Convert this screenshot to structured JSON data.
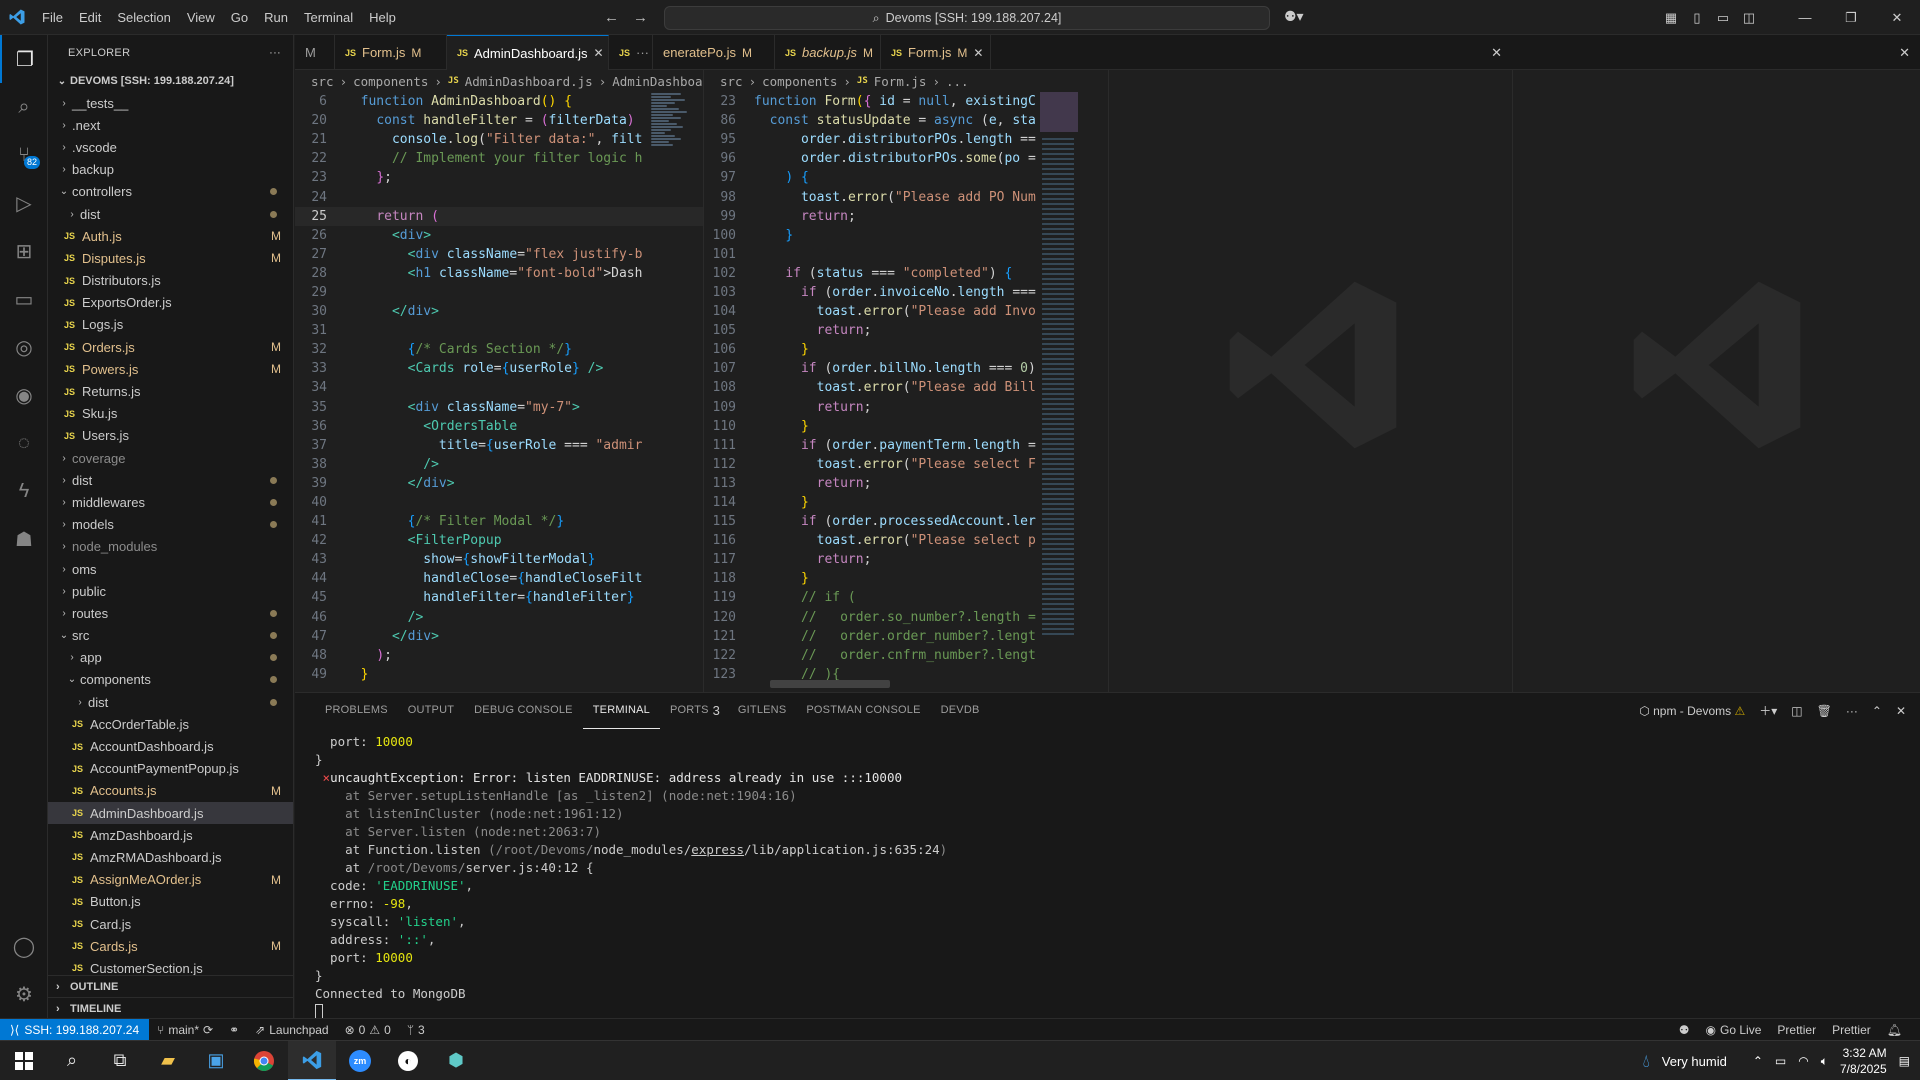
{
  "menu": [
    "File",
    "Edit",
    "Selection",
    "View",
    "Go",
    "Run",
    "Terminal",
    "Help"
  ],
  "command_center": "Devoms [SSH: 199.188.207.24]",
  "explorer": {
    "title": "EXPLORER",
    "root": "DEVOMS [SSH: 199.188.207.24]",
    "items": [
      {
        "label": "__tests__",
        "indent": 1,
        "type": "folder",
        "open": false
      },
      {
        "label": ".next",
        "indent": 1,
        "type": "folder",
        "open": false
      },
      {
        "label": ".vscode",
        "indent": 1,
        "type": "folder",
        "open": false
      },
      {
        "label": "backup",
        "indent": 1,
        "type": "folder",
        "open": false
      },
      {
        "label": "controllers",
        "indent": 1,
        "type": "folder",
        "open": true,
        "dot": true
      },
      {
        "label": "dist",
        "indent": 2,
        "type": "folder",
        "open": false,
        "dot": true
      },
      {
        "label": "Auth.js",
        "indent": 2,
        "type": "js",
        "status": "M"
      },
      {
        "label": "Disputes.js",
        "indent": 2,
        "type": "js",
        "status": "M"
      },
      {
        "label": "Distributors.js",
        "indent": 2,
        "type": "js"
      },
      {
        "label": "ExportsOrder.js",
        "indent": 2,
        "type": "js"
      },
      {
        "label": "Logs.js",
        "indent": 2,
        "type": "js"
      },
      {
        "label": "Orders.js",
        "indent": 2,
        "type": "js",
        "status": "M"
      },
      {
        "label": "Powers.js",
        "indent": 2,
        "type": "js",
        "status": "M"
      },
      {
        "label": "Returns.js",
        "indent": 2,
        "type": "js"
      },
      {
        "label": "Sku.js",
        "indent": 2,
        "type": "js"
      },
      {
        "label": "Users.js",
        "indent": 2,
        "type": "js"
      },
      {
        "label": "coverage",
        "indent": 1,
        "type": "folder",
        "open": false,
        "dim": true
      },
      {
        "label": "dist",
        "indent": 1,
        "type": "folder",
        "open": false,
        "dot": true
      },
      {
        "label": "middlewares",
        "indent": 1,
        "type": "folder",
        "open": false,
        "dot": true
      },
      {
        "label": "models",
        "indent": 1,
        "type": "folder",
        "open": false,
        "dot": true
      },
      {
        "label": "node_modules",
        "indent": 1,
        "type": "folder",
        "open": false,
        "dim": true
      },
      {
        "label": "oms",
        "indent": 1,
        "type": "folder",
        "open": false
      },
      {
        "label": "public",
        "indent": 1,
        "type": "folder",
        "open": false
      },
      {
        "label": "routes",
        "indent": 1,
        "type": "folder",
        "open": false,
        "dot": true
      },
      {
        "label": "src",
        "indent": 1,
        "type": "folder",
        "open": true,
        "dot": true
      },
      {
        "label": "app",
        "indent": 2,
        "type": "folder",
        "open": false,
        "dot": true
      },
      {
        "label": "components",
        "indent": 2,
        "type": "folder",
        "open": true,
        "dot": true
      },
      {
        "label": "dist",
        "indent": 3,
        "type": "folder",
        "open": false,
        "dot": true
      },
      {
        "label": "AccOrderTable.js",
        "indent": 3,
        "type": "js"
      },
      {
        "label": "AccountDashboard.js",
        "indent": 3,
        "type": "js"
      },
      {
        "label": "AccountPaymentPopup.js",
        "indent": 3,
        "type": "js"
      },
      {
        "label": "Accounts.js",
        "indent": 3,
        "type": "js",
        "status": "M"
      },
      {
        "label": "AdminDashboard.js",
        "indent": 3,
        "type": "js",
        "selected": true
      },
      {
        "label": "AmzDashboard.js",
        "indent": 3,
        "type": "js"
      },
      {
        "label": "AmzRMADashboard.js",
        "indent": 3,
        "type": "js"
      },
      {
        "label": "AssignMeAOrder.js",
        "indent": 3,
        "type": "js",
        "status": "M"
      },
      {
        "label": "Button.js",
        "indent": 3,
        "type": "js"
      },
      {
        "label": "Card.js",
        "indent": 3,
        "type": "js"
      },
      {
        "label": "Cards.js",
        "indent": 3,
        "type": "js",
        "status": "M"
      },
      {
        "label": "CustomerSection.js",
        "indent": 3,
        "type": "js"
      }
    ],
    "outline": "OUTLINE",
    "timeline": "TIMELINE"
  },
  "tabs": [
    {
      "label": "M",
      "js": false,
      "modified": false
    },
    {
      "label": "Form.js",
      "js": true,
      "modified": "M"
    },
    {
      "label": "AdminDashboard.js",
      "js": true,
      "active": true,
      "close": true
    },
    {
      "label": "",
      "js": true,
      "more": true
    },
    {
      "label": "eneratePo.js",
      "js": false,
      "modified": "M"
    },
    {
      "label": "backup.js",
      "js": true,
      "modified": "M",
      "italic": true
    },
    {
      "label": "Form.js",
      "js": true,
      "modified": "M",
      "close": true,
      "active": true
    }
  ],
  "left_editor": {
    "breadcrumb": [
      "src",
      "components",
      "AdminDashboard.js",
      "AdminDashboarc"
    ],
    "lines": [
      {
        "n": "6",
        "html": "  <span class='kw'>function</span> <span class='fn'>AdminDashboard</span><span class='br1'>()</span> <span class='br1'>{</span>"
      },
      {
        "n": "20",
        "html": "    <span class='kw'>const</span> <span class='fn'>handleFilter</span> = <span class='br2'>(</span><span class='var'>filterData</span><span class='br2'>)</span>"
      },
      {
        "n": "21",
        "html": "      <span class='var'>console</span>.<span class='fn'>log</span>(<span class='str'>\"Filter data:\"</span>, <span class='var'>filt</span>"
      },
      {
        "n": "22",
        "html": "      <span class='cm'>// Implement your filter logic h</span>"
      },
      {
        "n": "23",
        "html": "    <span class='br2'>}</span>;"
      },
      {
        "n": "24",
        "html": ""
      },
      {
        "n": "25",
        "html": "    <span class='ctl'>return</span> <span class='br2'>(</span>",
        "cur": true
      },
      {
        "n": "26",
        "html": "      <span class='tag'>&lt;</span><span class='kw'>div</span><span class='tag'>&gt;</span>"
      },
      {
        "n": "27",
        "html": "        <span class='tag'>&lt;</span><span class='kw'>div</span> <span class='var'>className</span>=<span class='str'>\"flex justify-b</span>"
      },
      {
        "n": "28",
        "html": "        <span class='tag'>&lt;</span><span class='kw'>h1</span> <span class='var'>className</span>=<span class='str'>\"font-bold\"</span>&gt;Dash"
      },
      {
        "n": "29",
        "html": ""
      },
      {
        "n": "30",
        "html": "      <span class='tag'>&lt;/</span><span class='kw'>div</span><span class='tag'>&gt;</span>"
      },
      {
        "n": "31",
        "html": ""
      },
      {
        "n": "32",
        "html": "        <span class='br3'>{</span><span class='cm'>/* Cards Section */</span><span class='br3'>}</span>"
      },
      {
        "n": "33",
        "html": "        <span class='tag'>&lt;Cards</span> <span class='var'>role</span>=<span class='br3'>{</span><span class='var'>userRole</span><span class='br3'>}</span> <span class='tag'>/&gt;</span>"
      },
      {
        "n": "34",
        "html": ""
      },
      {
        "n": "35",
        "html": "        <span class='tag'>&lt;</span><span class='kw'>div</span> <span class='var'>className</span>=<span class='str'>\"my-7\"</span><span class='tag'>&gt;</span>"
      },
      {
        "n": "36",
        "html": "          <span class='tag'>&lt;OrdersTable</span>"
      },
      {
        "n": "37",
        "html": "            <span class='var'>title</span>=<span class='br3'>{</span><span class='var'>userRole</span> === <span class='str'>\"admir</span>"
      },
      {
        "n": "38",
        "html": "          <span class='tag'>/&gt;</span>"
      },
      {
        "n": "39",
        "html": "        <span class='tag'>&lt;/</span><span class='kw'>div</span><span class='tag'>&gt;</span>"
      },
      {
        "n": "40",
        "html": ""
      },
      {
        "n": "41",
        "html": "        <span class='br3'>{</span><span class='cm'>/* Filter Modal */</span><span class='br3'>}</span>"
      },
      {
        "n": "42",
        "html": "        <span class='tag'>&lt;FilterPopup</span>"
      },
      {
        "n": "43",
        "html": "          <span class='var'>show</span>=<span class='br3'>{</span><span class='var'>showFilterModal</span><span class='br3'>}</span>"
      },
      {
        "n": "44",
        "html": "          <span class='var'>handleClose</span>=<span class='br3'>{</span><span class='var'>handleCloseFilt</span>"
      },
      {
        "n": "45",
        "html": "          <span class='var'>handleFilter</span>=<span class='br3'>{</span><span class='var'>handleFilter</span><span class='br3'>}</span>"
      },
      {
        "n": "46",
        "html": "        <span class='tag'>/&gt;</span>"
      },
      {
        "n": "47",
        "html": "      <span class='tag'>&lt;/</span><span class='kw'>div</span><span class='tag'>&gt;</span>"
      },
      {
        "n": "48",
        "html": "    <span class='br2'>)</span>;"
      },
      {
        "n": "49",
        "html": "  <span class='br1'>}</span>"
      }
    ]
  },
  "right_editor": {
    "breadcrumb": [
      "src",
      "components",
      "Form.js",
      "..."
    ],
    "lines": [
      {
        "n": "23",
        "html": "<span class='kw'>function</span> <span class='fn'>Form</span><span class='br1'>(</span><span class='br2'>{</span> <span class='var'>id</span> = <span class='kw'>null</span>, <span class='var'>existingC</span>"
      },
      {
        "n": "86",
        "html": "  <span class='kw'>const</span> <span class='fn'>statusUpdate</span> = <span class='kw'>async</span> (<span class='var'>e</span>, <span class='var'>sta</span>"
      },
      {
        "n": "95",
        "html": "      <span class='var'>order</span>.<span class='var'>distributorPOs</span>.<span class='var'>length</span> =="
      },
      {
        "n": "96",
        "html": "      <span class='var'>order</span>.<span class='var'>distributorPOs</span>.<span class='fn'>some</span>(<span class='var'>po</span> ="
      },
      {
        "n": "97",
        "html": "    <span class='br3'>)</span> <span class='br3'>{</span>"
      },
      {
        "n": "98",
        "html": "      <span class='var'>toast</span>.<span class='fn'>error</span>(<span class='str'>\"Please add PO Num</span>"
      },
      {
        "n": "99",
        "html": "      <span class='ctl'>return</span>;"
      },
      {
        "n": "100",
        "html": "    <span class='br3'>}</span>"
      },
      {
        "n": "101",
        "html": ""
      },
      {
        "n": "102",
        "html": "    <span class='ctl'>if</span> (<span class='var'>status</span> === <span class='str'>\"completed\"</span>) <span class='br3'>{</span>"
      },
      {
        "n": "103",
        "html": "      <span class='ctl'>if</span> (<span class='var'>order</span>.<span class='var'>invoiceNo</span>.<span class='var'>length</span> ==="
      },
      {
        "n": "104",
        "html": "        <span class='var'>toast</span>.<span class='fn'>error</span>(<span class='str'>\"Please add Invo</span>"
      },
      {
        "n": "105",
        "html": "        <span class='ctl'>return</span>;"
      },
      {
        "n": "106",
        "html": "      <span class='br1'>}</span>"
      },
      {
        "n": "107",
        "html": "      <span class='ctl'>if</span> (<span class='var'>order</span>.<span class='var'>billNo</span>.<span class='var'>length</span> === <span class='num'>0</span>)"
      },
      {
        "n": "108",
        "html": "        <span class='var'>toast</span>.<span class='fn'>error</span>(<span class='str'>\"Please add Bill</span>"
      },
      {
        "n": "109",
        "html": "        <span class='ctl'>return</span>;"
      },
      {
        "n": "110",
        "html": "      <span class='br1'>}</span>"
      },
      {
        "n": "111",
        "html": "      <span class='ctl'>if</span> (<span class='var'>order</span>.<span class='var'>paymentTerm</span>.<span class='var'>length</span> ="
      },
      {
        "n": "112",
        "html": "        <span class='var'>toast</span>.<span class='fn'>error</span>(<span class='str'>\"Please select F</span>"
      },
      {
        "n": "113",
        "html": "        <span class='ctl'>return</span>;"
      },
      {
        "n": "114",
        "html": "      <span class='br1'>}</span>"
      },
      {
        "n": "115",
        "html": "      <span class='ctl'>if</span> (<span class='var'>order</span>.<span class='var'>processedAccount</span>.<span class='var'>ler</span>"
      },
      {
        "n": "116",
        "html": "        <span class='var'>toast</span>.<span class='fn'>error</span>(<span class='str'>\"Please select p</span>"
      },
      {
        "n": "117",
        "html": "        <span class='ctl'>return</span>;"
      },
      {
        "n": "118",
        "html": "      <span class='br1'>}</span>"
      },
      {
        "n": "119",
        "html": "      <span class='cm'>// if (</span>"
      },
      {
        "n": "120",
        "html": "      <span class='cm'>//   order.so_number?.length =</span>"
      },
      {
        "n": "121",
        "html": "      <span class='cm'>//   order.order_number?.lengt</span>"
      },
      {
        "n": "122",
        "html": "      <span class='cm'>//   order.cnfrm_number?.lengt</span>"
      },
      {
        "n": "123",
        "html": "      <span class='cm'>// ){</span>"
      }
    ]
  },
  "panel": {
    "tabs": [
      "PROBLEMS",
      "OUTPUT",
      "DEBUG CONSOLE",
      "TERMINAL",
      "PORTS",
      "GITLENS",
      "POSTMAN CONSOLE",
      "DEVDB"
    ],
    "active_tab": "TERMINAL",
    "ports_count": "3",
    "terminal_name": "npm - Devoms",
    "terminal_lines": [
      {
        "html": "  port: <span class='t-yel'>10000</span>"
      },
      {
        "html": "}"
      },
      {
        "html": "<span class='t-red'> ×</span> <span class='t-wht'>uncaughtException: Error: listen EADDRINUSE: address already in use :::10000</span>"
      },
      {
        "html": "<span class='t-dim'>    at Server.setupListenHandle [as _listen2] (node:net:1904:16)</span>"
      },
      {
        "html": "<span class='t-dim'>    at listenInCluster (node:net:1961:12)</span>"
      },
      {
        "html": "<span class='t-dim'>    at Server.listen (node:net:2063:7)</span>"
      },
      {
        "html": "    at Function.listen <span class='t-dim'>(/root/Devoms/</span>node_modules/<u>express</u>/lib/application.js:635:24<span class='t-dim'>)</span>"
      },
      {
        "html": "    at <span class='t-dim'>/root/Devoms/</span>server.js:40:12 {"
      },
      {
        "html": "  code: <span class='t-grn'>'EADDRINUSE'</span>,"
      },
      {
        "html": "  errno: <span class='t-yel'>-98</span>,"
      },
      {
        "html": "  syscall: <span class='t-grn'>'listen'</span>,"
      },
      {
        "html": "  address: <span class='t-grn'>'::'</span>,"
      },
      {
        "html": "  port: <span class='t-yel'>10000</span>"
      },
      {
        "html": "}"
      },
      {
        "html": "Connected to MongoDB"
      },
      {
        "html": "<span style='display:inline-block;width:8px;height:15px;border:1px solid #ccc;'></span>"
      }
    ]
  },
  "statusbar": {
    "remote": "SSH: 199.188.207.24",
    "branch": "main*",
    "launchpad": "Launchpad",
    "errors": "0",
    "warnings": "0",
    "ports": "3",
    "golive": "Go Live",
    "prettier1": "Prettier",
    "prettier2": "Prettier"
  },
  "taskbar": {
    "weather": "Very humid",
    "time": "3:32 AM",
    "date": "7/8/2025"
  }
}
